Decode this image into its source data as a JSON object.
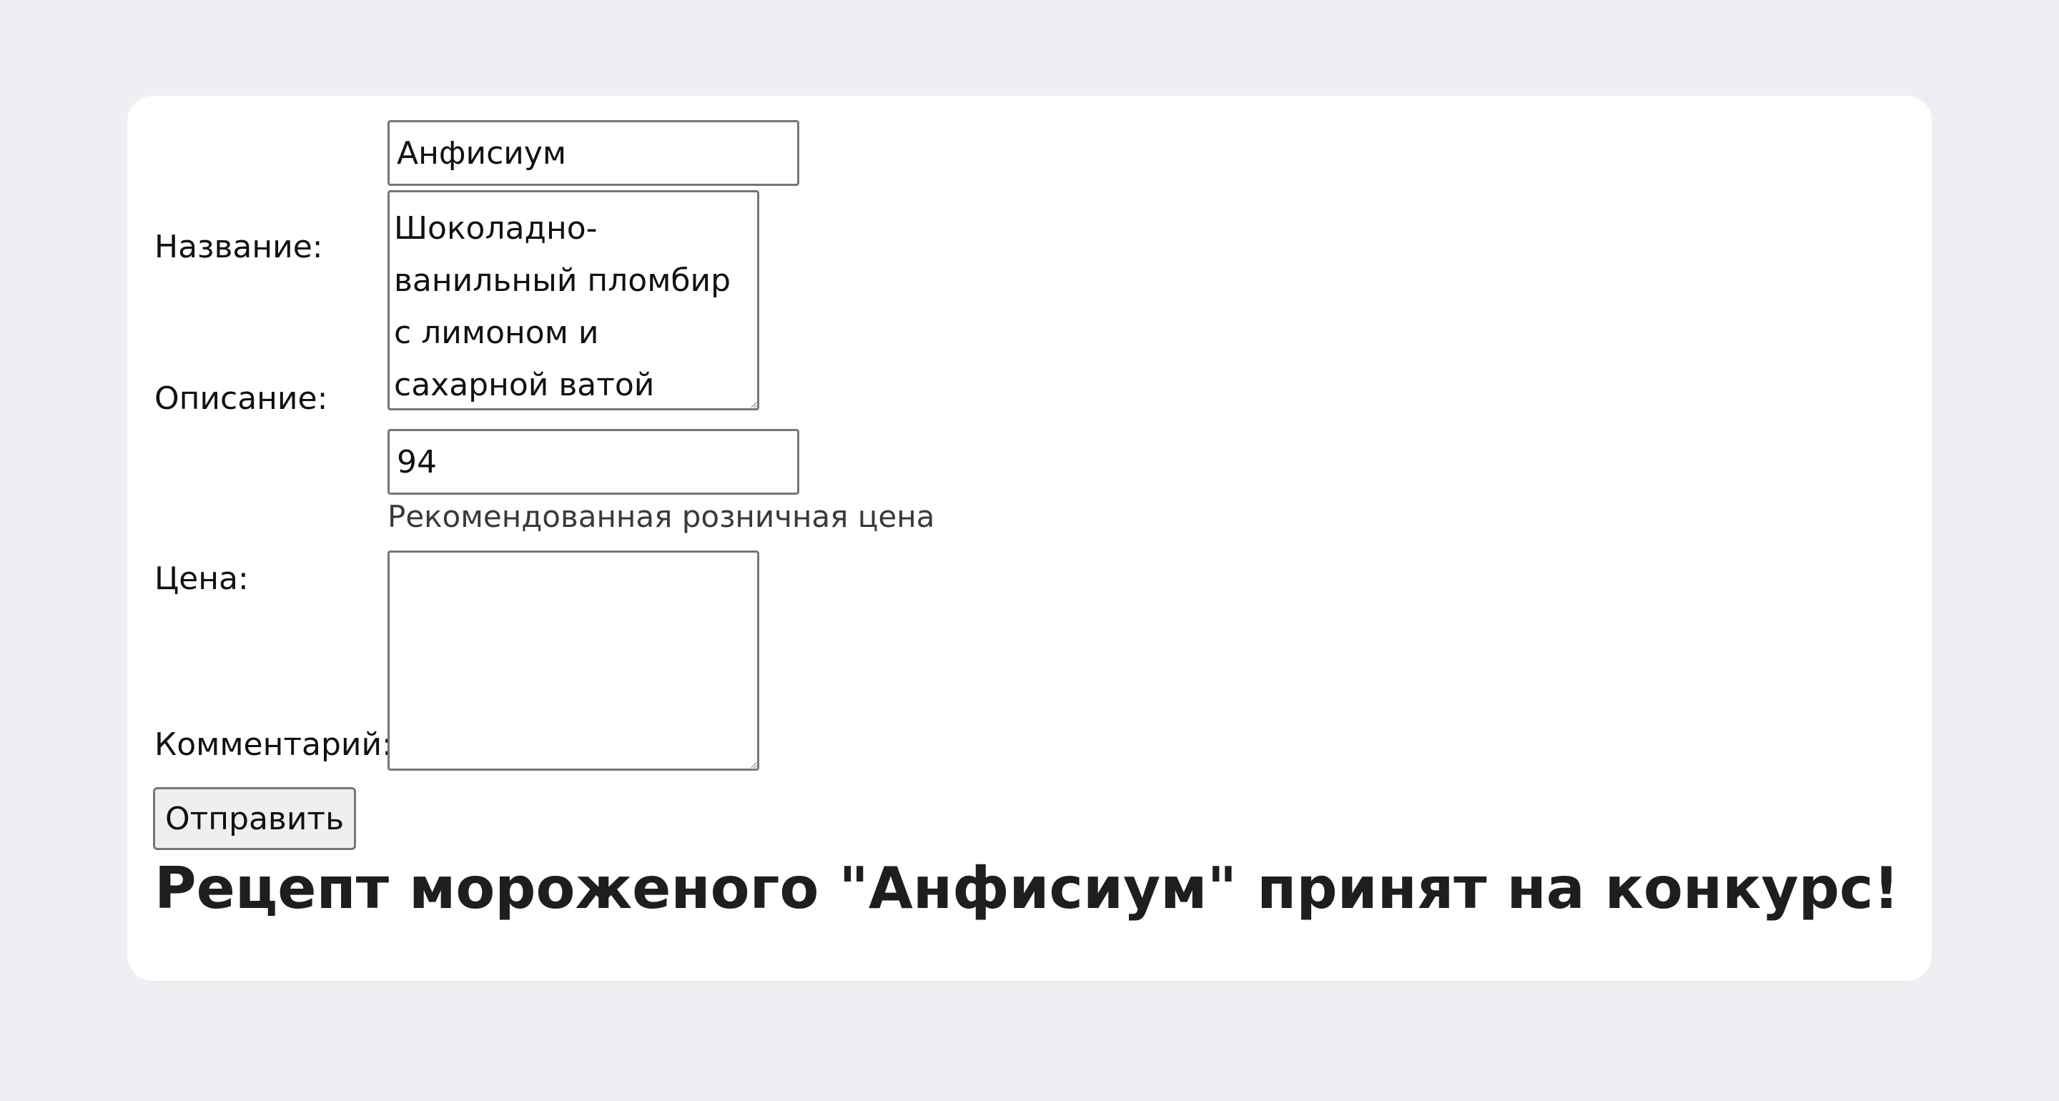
{
  "form": {
    "name_label": "Название:",
    "name_value": "Анфисиум",
    "description_label": "Описание:",
    "description_value": "Шоколадно-ванильный пломбир с лимоном и сахарной ватой",
    "price_label": "Цена:",
    "price_value": "94",
    "price_hint": "Рекомендованная розничная цена",
    "comment_label": "Комментарий:",
    "comment_value": "",
    "submit_label": "Отправить"
  },
  "result": {
    "message": "Рецепт мороженого \"Анфисиум\" принят на конкурс!"
  }
}
